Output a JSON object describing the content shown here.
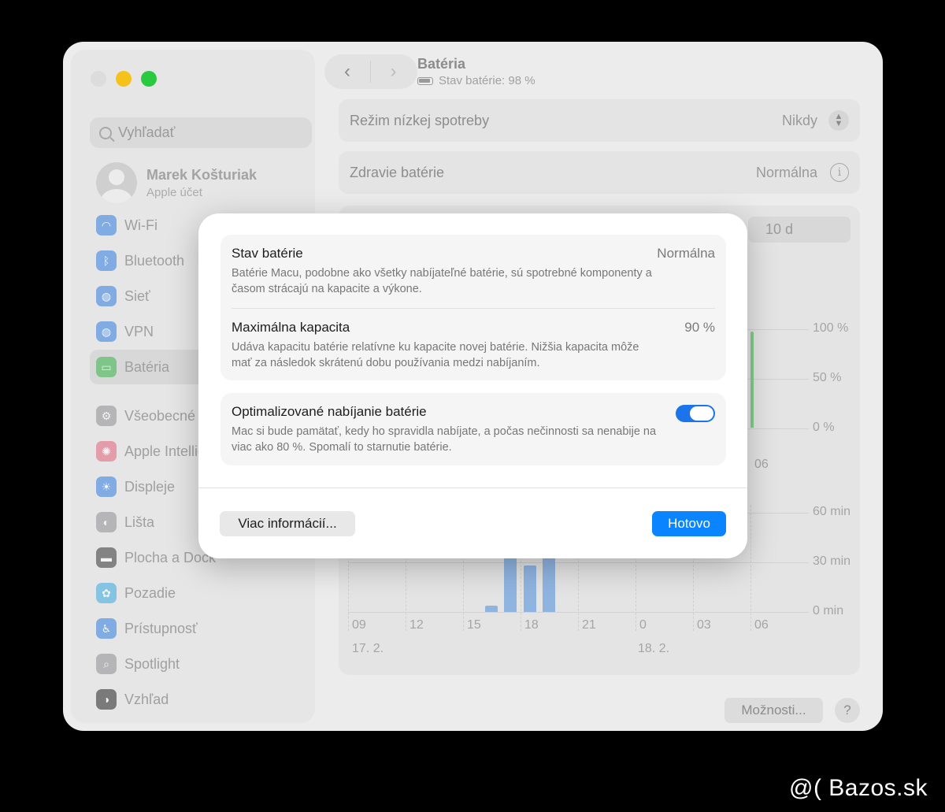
{
  "window": {
    "sidebar": {
      "search_placeholder": "Vyhľadať",
      "account_name": "Marek Košturiak",
      "account_sub": "Apple účet",
      "items": [
        {
          "label": "Wi-Fi",
          "icon": "wifi-icon",
          "color": "#2f7de1"
        },
        {
          "label": "Bluetooth",
          "icon": "bluetooth-icon",
          "color": "#2f7de1"
        },
        {
          "label": "Sieť",
          "icon": "globe-icon",
          "color": "#2f7de1"
        },
        {
          "label": "VPN",
          "icon": "vpn-globe-icon",
          "color": "#2f7de1"
        },
        {
          "label": "Batéria",
          "icon": "battery-icon",
          "color": "#38b44a"
        },
        {
          "label": "Všeobecné",
          "icon": "gear-icon",
          "color": "#8e8e93"
        },
        {
          "label": "Apple Intellig",
          "icon": "apple-intelligence-icon",
          "color": "#e0607a"
        },
        {
          "label": "Displeje",
          "icon": "sun-icon",
          "color": "#2f7de1"
        },
        {
          "label": "Lišta",
          "icon": "toggles-icon",
          "color": "#8e8e93"
        },
        {
          "label": "Plocha a Dock",
          "icon": "dock-icon",
          "color": "#333333"
        },
        {
          "label": "Pozadie",
          "icon": "flower-icon",
          "color": "#36a8e0"
        },
        {
          "label": "Prístupnosť",
          "icon": "accessibility-icon",
          "color": "#2f7de1"
        },
        {
          "label": "Spotlight",
          "icon": "magnifier-icon",
          "color": "#8e8e93"
        },
        {
          "label": "Vzhľad",
          "icon": "appearance-icon",
          "color": "#222222"
        }
      ]
    },
    "header": {
      "title": "Batéria",
      "subtitle": "Stav batérie: 98 %"
    },
    "rows": {
      "low_power_label": "Režim nízkej spotreby",
      "low_power_value": "Nikdy",
      "health_label": "Zdravie batérie",
      "health_value": "Normálna"
    },
    "chart": {
      "segment_label": "10 d",
      "level_axis": [
        "100 %",
        "50 %",
        "0 %"
      ],
      "usage_axis": [
        "60 min",
        "30 min",
        "0 min"
      ],
      "x_ticks": [
        "09",
        "12",
        "15",
        "18",
        "21",
        "0",
        "03",
        "06"
      ],
      "top_x_tick": "06",
      "dates": [
        "17. 2.",
        "18. 2."
      ]
    },
    "chart_data": {
      "type": "bar",
      "ylabel": "",
      "ylim": [
        0,
        60
      ],
      "categories": [
        "16",
        "17",
        "18",
        "19"
      ],
      "values": [
        4,
        60,
        28,
        60
      ]
    },
    "bottom": {
      "options_button": "Možnosti...",
      "help_button": "?"
    }
  },
  "modal": {
    "group1": {
      "status_title": "Stav batérie",
      "status_value": "Normálna",
      "status_desc": "Batérie Macu, podobne ako všetky nabíjateľné batérie, sú spotrebné komponenty a časom strácajú na kapacite a výkone.",
      "capacity_title": "Maximálna kapacita",
      "capacity_value": "90 %",
      "capacity_desc": "Udáva kapacitu batérie relatívne ku kapacite novej batérie. Nižšia kapacita môže mať za následok skrátenú dobu používania medzi nabíjaním."
    },
    "group2": {
      "opt_title": "Optimalizované nabíjanie batérie",
      "opt_desc": "Mac si bude pamätať, kedy ho spravidla nabíjate, a počas nečinnosti sa nenabije na viac ako 80 %. Spomalí to starnutie batérie.",
      "opt_enabled": true
    },
    "more_button": "Viac informácií...",
    "done_button": "Hotovo"
  },
  "watermark": "@( Bazos.sk",
  "colors": {
    "accent": "#0a84ff",
    "toggle_on": "#1b74e9",
    "bar": "#8fb4e0",
    "level_bar": "#7fcf8a"
  }
}
